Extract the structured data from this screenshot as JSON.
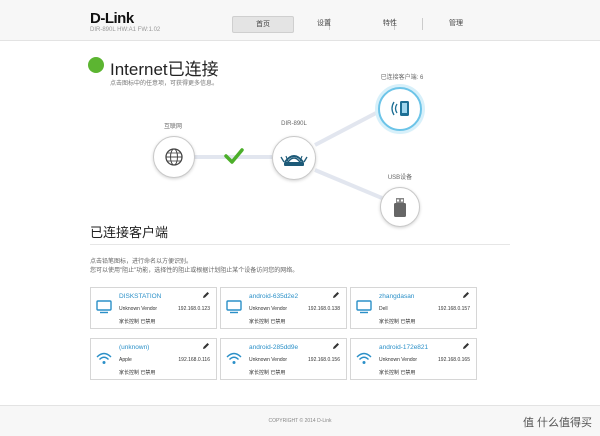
{
  "header": {
    "logo": "D-Link",
    "model_info": "DIR-890L   HW:A1   FW:1.02",
    "nav": [
      {
        "label": "首页",
        "active": true
      },
      {
        "label": "设置",
        "active": false
      },
      {
        "label": "特性",
        "active": false
      },
      {
        "label": "管理",
        "active": false
      }
    ]
  },
  "status": {
    "title": "Internet已连接",
    "subtitle": "点击图标中的任意项，可获得更多信息。",
    "color": "#5cb531"
  },
  "topology": {
    "internet_label": "互联网",
    "router_label": "DIR-890L",
    "clients_label": "已连接客户端: 6",
    "usb_label": "USB设备"
  },
  "clients": {
    "title": "已连接客户端",
    "hint_line1": "点击铅笔图标，进行命名以方便识别。",
    "hint_line2": "您可以使用\"阻止\"功能，选择性的阻止或根据计划阻止某个设备访问您的网络。",
    "items": [
      {
        "name": "DISKSTATION",
        "vendor": "Unknown Vendor",
        "ip": "192.168.0.123",
        "control": "家长控制  已禁用",
        "icon": "monitor-icon"
      },
      {
        "name": "android-635d2e2",
        "vendor": "Unknown Vendor",
        "ip": "192.168.0.138",
        "control": "家长控制  已禁用",
        "icon": "monitor-icon"
      },
      {
        "name": "zhangdasan",
        "vendor": "Dell",
        "ip": "192.168.0.157",
        "control": "家长控制  已禁用",
        "icon": "monitor-icon"
      },
      {
        "name": "(unknown)",
        "vendor": "Apple",
        "ip": "192.168.0.116",
        "control": "家长控制  已禁用",
        "icon": "wifi-icon"
      },
      {
        "name": "android-285dd9e",
        "vendor": "Unknown Vendor",
        "ip": "192.168.0.156",
        "control": "家长控制  已禁用",
        "icon": "wifi-icon"
      },
      {
        "name": "android-172e821",
        "vendor": "Unknown Vendor",
        "ip": "192.168.0.165",
        "control": "家长控制  已禁用",
        "icon": "wifi-icon"
      }
    ]
  },
  "footer": {
    "copyright": "COPYRIGHT © 2014 D-Link"
  },
  "watermark": "值 什么值得买",
  "colors": {
    "accent": "#2b90c8",
    "highlight_ring": "#6cc4e8",
    "check": "#4caf2a"
  }
}
